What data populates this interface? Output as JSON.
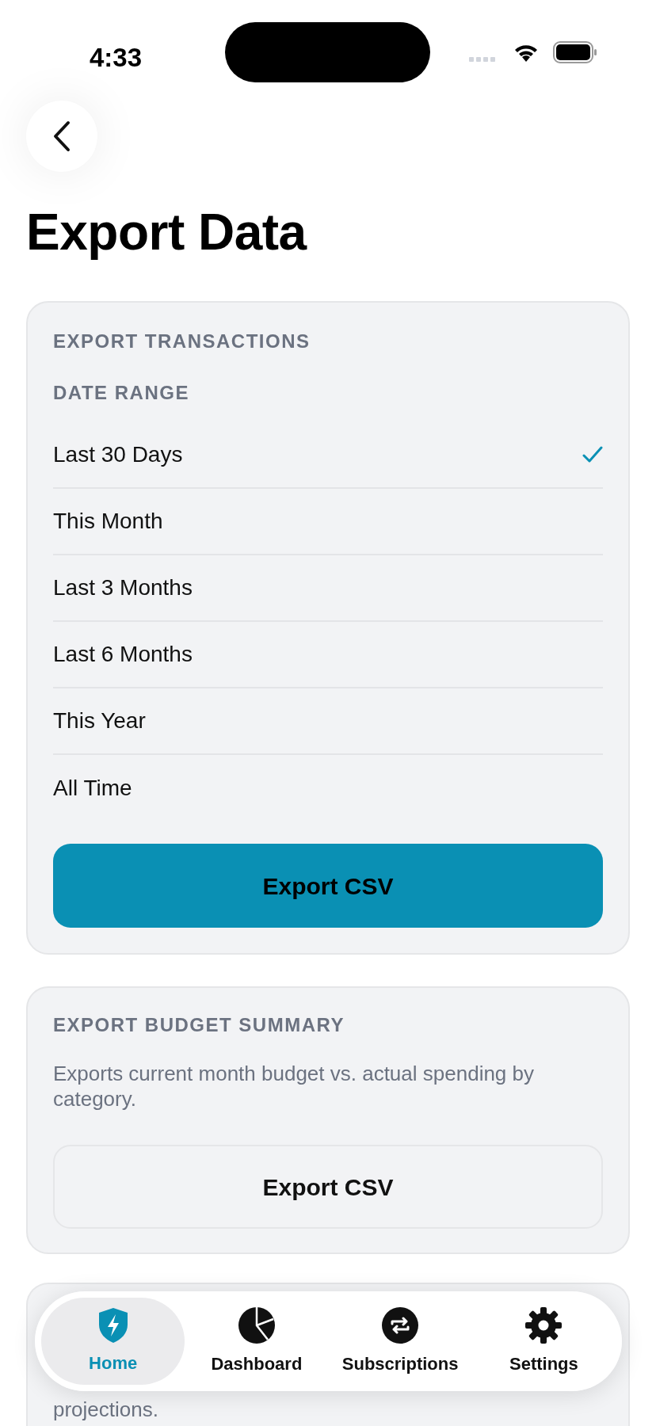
{
  "status_bar": {
    "time": "4:33"
  },
  "title": "Export Data",
  "transactions": {
    "heading": "EXPORT TRANSACTIONS",
    "subheading": "DATE RANGE",
    "options": [
      {
        "label": "Last 30 Days",
        "selected": true
      },
      {
        "label": "This Month",
        "selected": false
      },
      {
        "label": "Last 3 Months",
        "selected": false
      },
      {
        "label": "Last 6 Months",
        "selected": false
      },
      {
        "label": "This Year",
        "selected": false
      },
      {
        "label": "All Time",
        "selected": false
      }
    ],
    "button": "Export CSV"
  },
  "budget": {
    "heading": "EXPORT BUDGET SUMMARY",
    "description": "Exports current month budget vs. actual spending by category.",
    "button": "Export CSV"
  },
  "third_card": {
    "description_tail": "projections."
  },
  "tab_bar": [
    {
      "label": "Home",
      "kind": "shield",
      "selected": true
    },
    {
      "label": "Dashboard",
      "kind": "pie",
      "selected": false
    },
    {
      "label": "Subscriptions",
      "kind": "repeat",
      "selected": false
    },
    {
      "label": "Settings",
      "kind": "gear",
      "selected": false
    }
  ]
}
